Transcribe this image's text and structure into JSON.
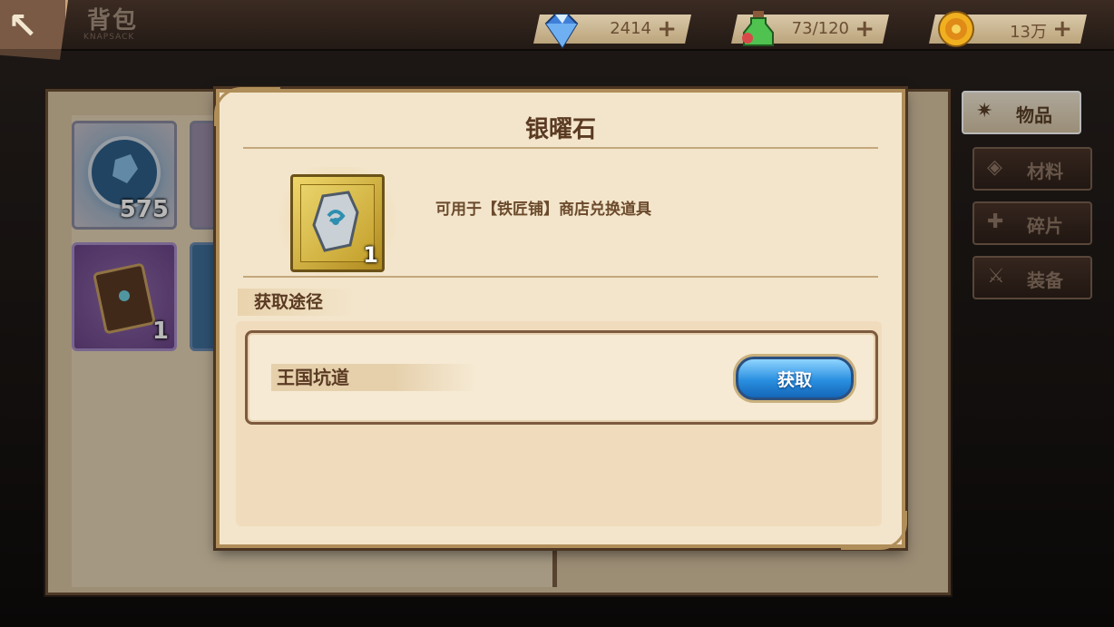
{
  "header": {
    "back_icon": "back-arrow-icon",
    "title": "背包",
    "subtitle": "KNAPSACK",
    "resources": [
      {
        "icon": "diamond-icon",
        "value": "2414",
        "plus": "+"
      },
      {
        "icon": "stamina-potion-icon",
        "value": "73/120",
        "plus": "+"
      },
      {
        "icon": "gold-coin-icon",
        "value": "13万",
        "plus": "+"
      }
    ]
  },
  "inventory": {
    "slots": [
      {
        "icon": "crystal-orb-icon",
        "count": "575"
      },
      {
        "icon": "spellbook-icon",
        "count": "1"
      }
    ]
  },
  "tabs": [
    {
      "label": "物品",
      "icon": "star-icon",
      "active": true
    },
    {
      "label": "材料",
      "icon": "crystal-icon",
      "active": false
    },
    {
      "label": "碎片",
      "icon": "puzzle-icon",
      "active": false
    },
    {
      "label": "装备",
      "icon": "sword-icon",
      "active": false
    }
  ],
  "modal": {
    "item_name": "银曜石",
    "item_icon": "silver-obsidian-stone-icon",
    "item_count": "1",
    "description": "可用于【铁匠铺】商店兑换道具",
    "source_label": "获取途径",
    "sources": [
      {
        "name": "王国坑道",
        "button": "获取"
      }
    ]
  },
  "colors": {
    "modal_bg": "#f3e5cb",
    "frame_gold": "#b08e5a",
    "text_brown": "#5a3a22",
    "button_blue": "#2a8fe0"
  }
}
